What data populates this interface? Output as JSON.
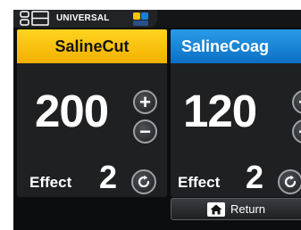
{
  "top_bar": {
    "mode_label": "UNIVERSAL",
    "icons": [
      "channel-layout-icon",
      "footswitch-icon"
    ]
  },
  "channels": [
    {
      "name": "SalineCut",
      "power": "200",
      "effect_label": "Effect",
      "effect_value": "2",
      "header_color": "#f8c400"
    },
    {
      "name": "SalineCoag",
      "power": "120",
      "effect_label": "Effect",
      "effect_value": "2",
      "header_color": "#1682d6"
    }
  ],
  "buttons": {
    "plus": "+",
    "minus": "−",
    "return_label": "Return"
  },
  "colors": {
    "background": "#0c0d0e",
    "panel": "#1f2022",
    "cut_yellow": "#f8c400",
    "coag_blue": "#1682d6"
  }
}
